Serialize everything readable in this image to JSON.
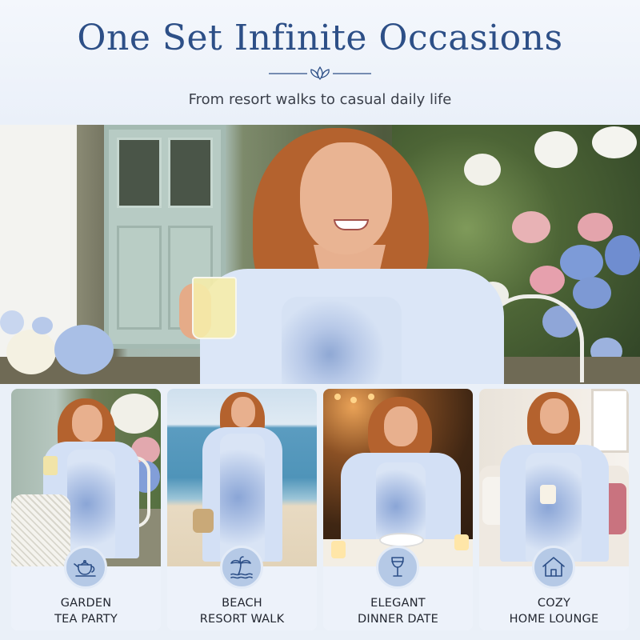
{
  "header": {
    "title": "One Set Infinite Occasions",
    "subtitle": "From resort walks to casual daily life"
  },
  "hero": {
    "icon": "hero-photo"
  },
  "cards": [
    {
      "line1": "GARDEN",
      "line2": "TEA PARTY",
      "icon": "teapot-icon"
    },
    {
      "line1": "BEACH",
      "line2": "RESORT WALK",
      "icon": "palm-tree-icon"
    },
    {
      "line1": "ELEGANT",
      "line2": "DINNER DATE",
      "icon": "wine-glass-icon"
    },
    {
      "line1": "COZY",
      "line2": "HOME LOUNGE",
      "icon": "house-icon"
    }
  ],
  "colors": {
    "title": "#2d4f87",
    "icon_circle": "#b5c9e6",
    "background": "#eef3fa"
  }
}
